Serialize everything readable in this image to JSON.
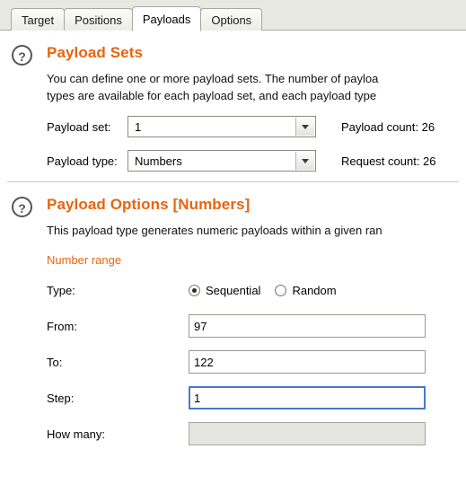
{
  "tabs": [
    {
      "label": "Target",
      "active": false
    },
    {
      "label": "Positions",
      "active": false
    },
    {
      "label": "Payloads",
      "active": true
    },
    {
      "label": "Options",
      "active": false
    }
  ],
  "help_icon_glyph": "?",
  "payload_sets": {
    "title": "Payload Sets",
    "description_line1": "You can define one or more payload sets. The number of payloa",
    "description_line2": "types are available for each payload set, and each payload type",
    "payload_set_label": "Payload set:",
    "payload_set_value": "1",
    "payload_count_label": "Payload count: 26",
    "payload_type_label": "Payload type:",
    "payload_type_value": "Numbers",
    "request_count_label": "Request count: 26"
  },
  "payload_options": {
    "title": "Payload Options [Numbers]",
    "description": "This payload type generates numeric payloads within a given ran",
    "number_range_label": "Number range",
    "type_label": "Type:",
    "type_options": [
      {
        "label": "Sequential",
        "selected": true
      },
      {
        "label": "Random",
        "selected": false
      }
    ],
    "from_label": "From:",
    "from_value": "97",
    "to_label": "To:",
    "to_value": "122",
    "step_label": "Step:",
    "step_value": "1",
    "how_many_label": "How many:",
    "how_many_value": ""
  }
}
